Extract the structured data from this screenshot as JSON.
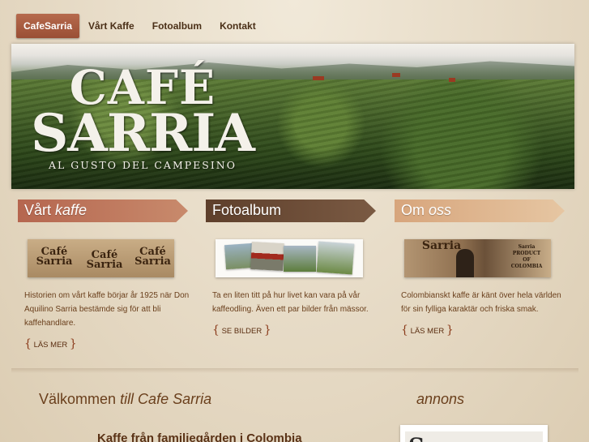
{
  "nav": {
    "items": [
      "CafeSarria",
      "Vårt Kaffe",
      "Fotoalbum",
      "Kontakt"
    ],
    "active_index": 0
  },
  "banner": {
    "logo_line1": "CAFÉ",
    "logo_line2": "SARRIA",
    "tagline": "AL GUSTO DEL CAMPESINO"
  },
  "columns": [
    {
      "title_plain": "Vårt",
      "title_italic": "kaffe",
      "color": "#b8705a",
      "image_bag_text": [
        "Café",
        "Sarria"
      ],
      "text": "Historien om vårt kaffe börjar år 1925 när Don Aquilino Sarria bestämde sig för att bli kaffehandlare.",
      "link": "LÄS MER"
    },
    {
      "title_plain": "Fotoalbum",
      "title_italic": "",
      "color": "#6b4a33",
      "text": "Ta en liten titt på hur livet kan vara på vår kaffeodling. Även ett par bilder från mässor.",
      "link": "SE BILDER"
    },
    {
      "title_plain": "Om",
      "title_italic": "oss",
      "color": "#d8ad85",
      "image_bag_text": [
        "Sarria",
        "PRODUCT",
        "OF",
        "COLOMBIA"
      ],
      "text": "Colombianskt kaffe är känt över hela världen för sin fylliga karaktär och friska smak.",
      "link": "LÄS MER"
    }
  ],
  "braces": {
    "open": "{",
    "close": "}"
  },
  "welcome": {
    "plain": "Välkommen",
    "italic": "till Cafe Sarria"
  },
  "annons": "annons",
  "sub_title": "Kaffe från familjegården i Colombia",
  "ad": {
    "letter": "S"
  }
}
